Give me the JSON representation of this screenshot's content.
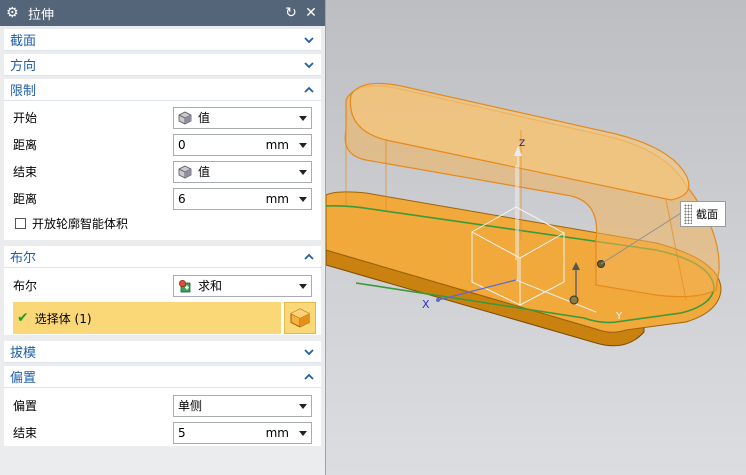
{
  "dialog": {
    "title": "拉伸",
    "reset_icon": "reset-icon",
    "close_icon": "close-icon"
  },
  "sections": {
    "section_label": "截面",
    "direction_label": "方向",
    "limits_label": "限制",
    "boolean_label": "布尔",
    "draft_label": "拔模",
    "offset_label": "偏置"
  },
  "limits": {
    "start_label": "开始",
    "start_value": "值",
    "start_distance_label": "距离",
    "start_distance": "0",
    "start_unit": "mm",
    "end_label": "结束",
    "end_value": "值",
    "end_distance_label": "距离",
    "end_distance": "6",
    "end_unit": "mm",
    "open_profile_label": "开放轮廓智能体积"
  },
  "boolean": {
    "label": "布尔",
    "value": "求和",
    "select_body_label": "选择体 (1)"
  },
  "offset": {
    "label": "偏置",
    "value": "单侧",
    "end_label": "结束",
    "end_value": "5",
    "end_unit": "mm"
  },
  "viewport": {
    "callout_label": "截面",
    "axis_x": "X",
    "axis_y": "Y",
    "axis_z": "Z"
  },
  "colors": {
    "title_bar": "#54657a",
    "section_title": "#1f5fa8",
    "selection_highlight": "#fbd877",
    "body_orange": "#f0a93a",
    "edge_green": "#3a9a3a"
  }
}
